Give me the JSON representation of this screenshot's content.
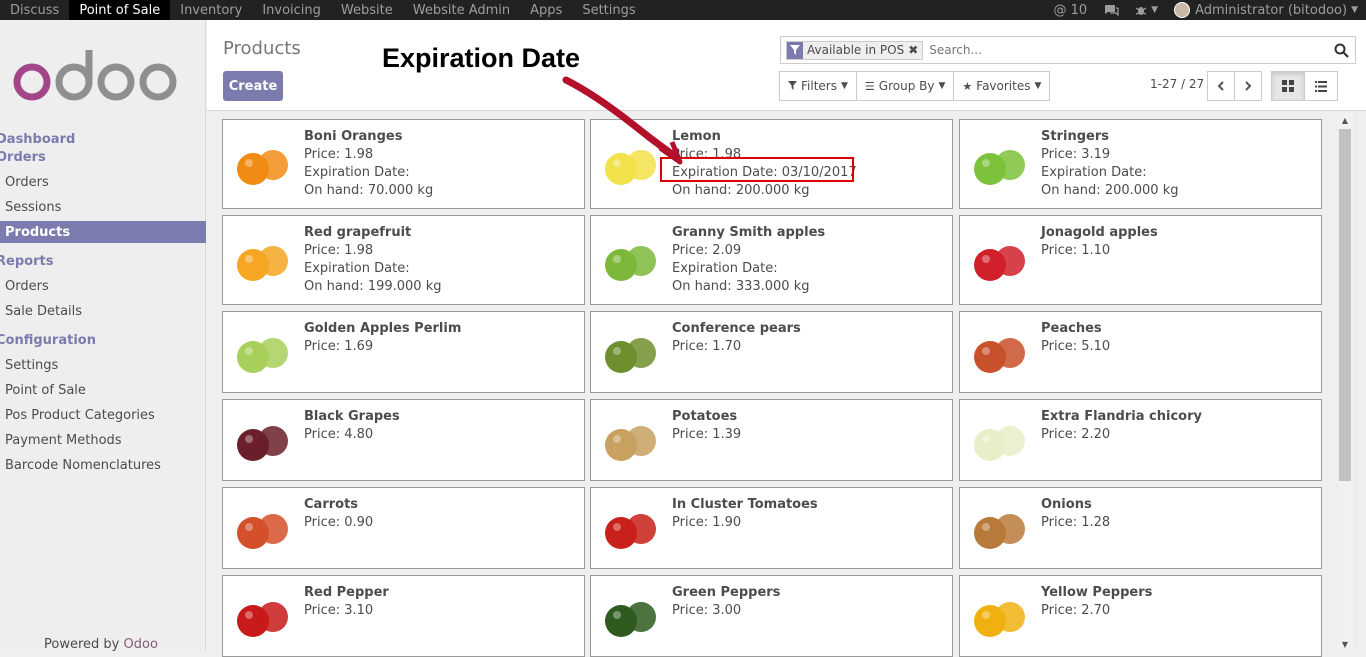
{
  "topbar": {
    "menu": [
      "Discuss",
      "Point of Sale",
      "Inventory",
      "Invoicing",
      "Website",
      "Website Admin",
      "Apps",
      "Settings"
    ],
    "mentions": "@ 10",
    "user": "Administrator (bitodoo)"
  },
  "sidebar": {
    "logo_text": "odoo",
    "sections": {
      "dashboard": "Dashboard",
      "orders": "Orders",
      "orders_items": [
        "Orders",
        "Sessions",
        "Products"
      ],
      "reports": "Reports",
      "reports_items": [
        "Orders",
        "Sale Details"
      ],
      "configuration": "Configuration",
      "configuration_items": [
        "Settings",
        "Point of Sale",
        "Pos Product Categories",
        "Payment Methods",
        "Barcode Nomenclatures"
      ]
    },
    "powered_prefix": "Powered by",
    "powered_brand": "Odoo"
  },
  "control": {
    "title": "Products",
    "create_label": "Create",
    "annotation": "Expiration Date",
    "facet": "Available in POS",
    "search_placeholder": "Search...",
    "filters_label": "Filters",
    "groupby_label": "Group By",
    "favorites_label": "Favorites",
    "pager": "1-27 / 27"
  },
  "products": [
    {
      "name": "Boni Oranges",
      "price": "Price: 1.98",
      "exp": "Expiration Date:",
      "onhand": "On hand: 70.000 kg",
      "color": "#f08c14"
    },
    {
      "name": "Lemon",
      "price": "Price: 1.98",
      "exp": "Expiration Date: 03/10/2017",
      "onhand": "On hand: 200.000 kg",
      "color": "#f2e14a"
    },
    {
      "name": "Stringers",
      "price": "Price: 3.19",
      "exp": "Expiration Date:",
      "onhand": "On hand: 200.000 kg",
      "color": "#7cc23a"
    },
    {
      "name": "Red grapefruit",
      "price": "Price: 1.98",
      "exp": "Expiration Date:",
      "onhand": "On hand: 199.000 kg",
      "color": "#f5a623"
    },
    {
      "name": "Granny Smith apples",
      "price": "Price: 2.09",
      "exp": "Expiration Date:",
      "onhand": "On hand: 333.000 kg",
      "color": "#7db83a"
    },
    {
      "name": "Jonagold apples",
      "price": "Price: 1.10",
      "color": "#d0202a"
    },
    {
      "name": "Golden Apples Perlim",
      "price": "Price: 1.69",
      "color": "#a8cf5a"
    },
    {
      "name": "Conference pears",
      "price": "Price: 1.70",
      "color": "#6e8f2e"
    },
    {
      "name": "Peaches",
      "price": "Price: 5.10",
      "color": "#c8502a"
    },
    {
      "name": "Black Grapes",
      "price": "Price: 4.80",
      "color": "#6a1f2a"
    },
    {
      "name": "Potatoes",
      "price": "Price: 1.39",
      "color": "#c8a060"
    },
    {
      "name": "Extra Flandria chicory",
      "price": "Price: 2.20",
      "color": "#e8eec8"
    },
    {
      "name": "Carrots",
      "price": "Price: 0.90",
      "color": "#d4502a"
    },
    {
      "name": "In Cluster Tomatoes",
      "price": "Price: 1.90",
      "color": "#c8201a"
    },
    {
      "name": "Onions",
      "price": "Price: 1.28",
      "color": "#b87a3a"
    },
    {
      "name": "Red Pepper",
      "price": "Price: 3.10",
      "color": "#c81a1a"
    },
    {
      "name": "Green Peppers",
      "price": "Price: 3.00",
      "color": "#2e5a1e"
    },
    {
      "name": "Yellow Peppers",
      "price": "Price: 2.70",
      "color": "#f0b010"
    }
  ]
}
